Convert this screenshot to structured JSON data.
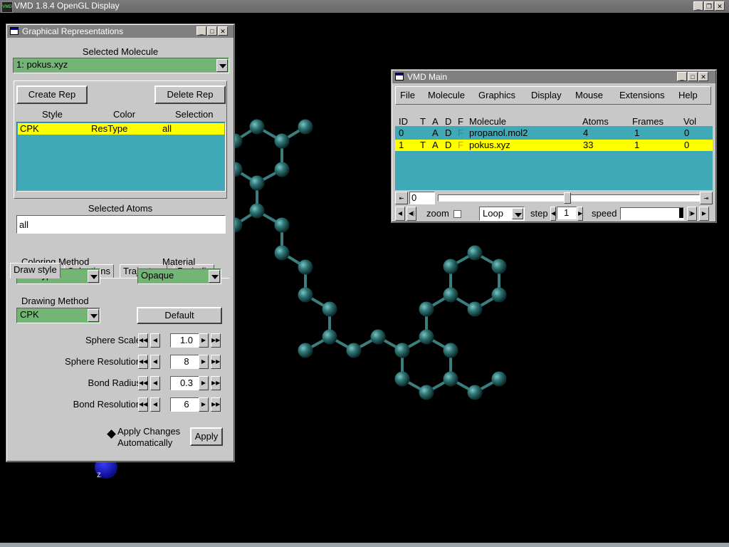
{
  "display": {
    "title": "VMD 1.8.4 OpenGL Display",
    "app_icon_text": "VMD",
    "axis_label": "z",
    "colors": {
      "atom": "#2f6f6f",
      "bond": "#3b7e7e",
      "background": "#000000"
    }
  },
  "graphical_reps": {
    "title": "Graphical Representations",
    "selected_molecule_label": "Selected Molecule",
    "selected_molecule": "1: pokus.xyz",
    "create_rep": "Create Rep",
    "delete_rep": "Delete Rep",
    "columns": [
      "Style",
      "Color",
      "Selection"
    ],
    "reps": [
      {
        "style": "CPK",
        "color": "ResType",
        "selection": "all"
      }
    ],
    "selected_atoms_label": "Selected Atoms",
    "selected_atoms": "all",
    "tabs": [
      "Draw style",
      "Selections",
      "Trajectory",
      "Periodic"
    ],
    "active_tab": "Draw style",
    "coloring_method_label": "Coloring Method",
    "coloring_method": "ResType",
    "material_label": "Material",
    "material": "Opaque",
    "drawing_method_label": "Drawing Method",
    "drawing_method": "CPK",
    "default_button": "Default",
    "params": [
      {
        "label": "Sphere Scale",
        "value": "1.0"
      },
      {
        "label": "Sphere Resolution",
        "value": "8"
      },
      {
        "label": "Bond Radius",
        "value": "0.3"
      },
      {
        "label": "Bond Resolution",
        "value": "6"
      }
    ],
    "apply_changes_line1": "Apply Changes",
    "apply_changes_line2": "Automatically",
    "apply_button": "Apply",
    "colors": {
      "combo": "#74b474",
      "list": "#3fa9b8",
      "highlight": "#ffff00"
    }
  },
  "vmd_main": {
    "title": "VMD Main",
    "menus": [
      "File",
      "Molecule",
      "Graphics",
      "Display",
      "Mouse",
      "Extensions",
      "Help"
    ],
    "columns": [
      "ID",
      "T",
      "A",
      "D",
      "F",
      "Molecule",
      "Atoms",
      "Frames",
      "Vol"
    ],
    "molecules": [
      {
        "id": "0",
        "t": "",
        "a": "A",
        "d": "D",
        "f": "F",
        "name": "propanol.mol2",
        "atoms": "4",
        "frames": "1",
        "vol": "0",
        "selected": false
      },
      {
        "id": "1",
        "t": "T",
        "a": "A",
        "d": "D",
        "f": "F",
        "name": "pokus.xyz",
        "atoms": "33",
        "frames": "1",
        "vol": "0",
        "selected": true
      }
    ],
    "frame_value": "0",
    "zoom_label": "zoom",
    "loop_mode": "Loop",
    "step_label": "step",
    "step_value": "1",
    "speed_label": "speed"
  }
}
